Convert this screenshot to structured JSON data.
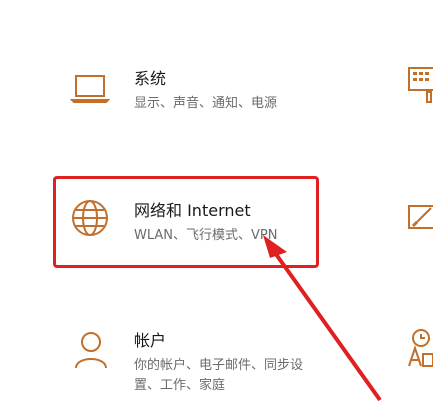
{
  "accent_color": "#c26f2b",
  "annotation_color": "#e02020",
  "tiles": [
    {
      "icon": "laptop-icon",
      "title": "系统",
      "desc": "显示、声音、通知、电源"
    },
    {
      "icon": "globe-icon",
      "title": "网络和 Internet",
      "desc": "WLAN、飞行模式、VPN"
    },
    {
      "icon": "person-icon",
      "title": "帐户",
      "desc_line1": "你的帐户、电子邮件、同步设",
      "desc_line2": "置、工作、家庭"
    }
  ],
  "right_column_icons": [
    "keyboard-icon",
    "personalization-icon",
    "time-language-icon"
  ]
}
